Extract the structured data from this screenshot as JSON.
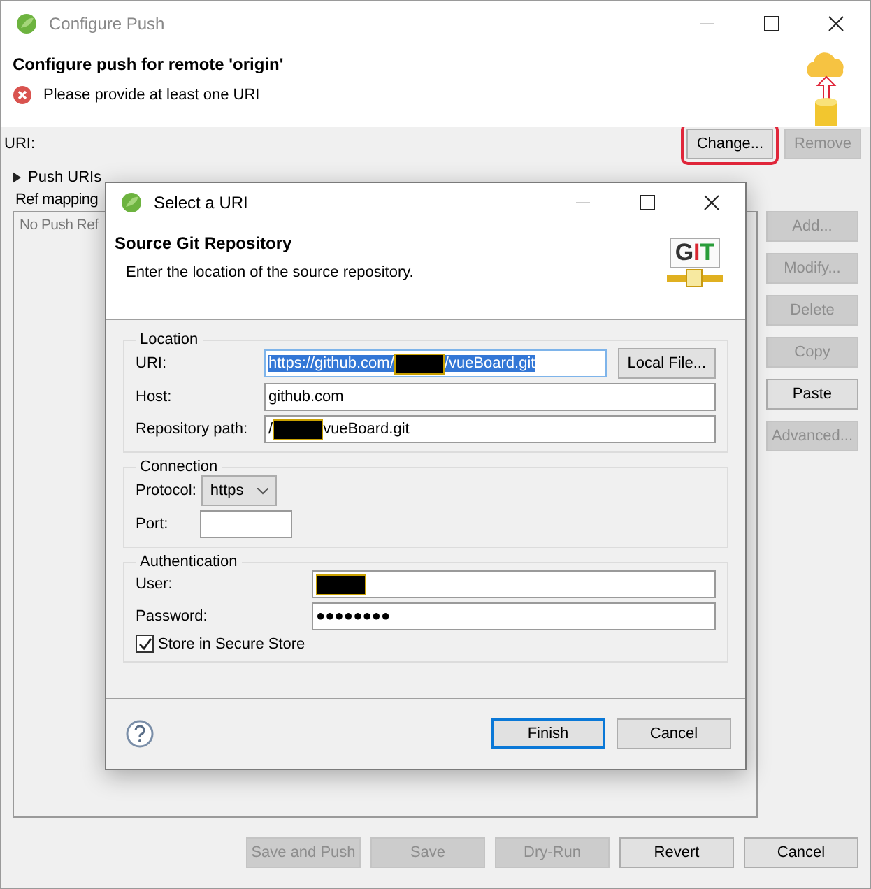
{
  "window": {
    "title": "Configure Push"
  },
  "header": {
    "title": "Configure push for remote 'origin'",
    "error": "Please provide at least one URI"
  },
  "uri_row": {
    "label": "URI:",
    "buttons": [
      {
        "label": "Change...",
        "disabled": false,
        "highlighted": true
      },
      {
        "label": "Remove",
        "disabled": true,
        "highlighted": false
      }
    ]
  },
  "push_uris": {
    "label": "Push URIs",
    "expanded": false
  },
  "ref_mapping": {
    "label": "Ref mapping",
    "empty_text": "No Push Ref"
  },
  "side_buttons": [
    {
      "label": "Add...",
      "disabled": true
    },
    {
      "label": "Modify...",
      "disabled": true
    },
    {
      "label": "Delete",
      "disabled": true
    },
    {
      "label": "Copy",
      "disabled": true
    },
    {
      "label": "Paste",
      "disabled": false
    },
    {
      "label": "Advanced...",
      "disabled": true
    }
  ],
  "bottom_buttons": [
    {
      "label": "Save and Push",
      "disabled": true
    },
    {
      "label": "Save",
      "disabled": true
    },
    {
      "label": "Dry-Run",
      "disabled": true
    },
    {
      "label": "Revert",
      "disabled": false
    },
    {
      "label": "Cancel",
      "disabled": false
    }
  ],
  "dialog": {
    "title": "Select a URI",
    "header": {
      "title": "Source Git Repository",
      "description": "Enter the location of the source repository.",
      "logo": "GIT"
    },
    "location": {
      "legend": "Location",
      "uri": {
        "label": "URI:",
        "before": "https://github.com/",
        "after": "/vueBoard.git",
        "selected": true
      },
      "local_file_button": "Local File...",
      "host": {
        "label": "Host:",
        "value": "github.com"
      },
      "repo_path": {
        "label": "Repository path:",
        "before": "/",
        "after": "vueBoard.git"
      }
    },
    "connection": {
      "legend": "Connection",
      "protocol": {
        "label": "Protocol:",
        "value": "https"
      },
      "port": {
        "label": "Port:"
      }
    },
    "authentication": {
      "legend": "Authentication",
      "user": {
        "label": "User:"
      },
      "password": {
        "label": "Password:",
        "value": "●●●●●●●●"
      },
      "store": {
        "label": "Store in Secure Store",
        "checked": true
      }
    },
    "buttons": [
      {
        "label": "Finish",
        "default": true
      },
      {
        "label": "Cancel",
        "default": false
      }
    ]
  }
}
